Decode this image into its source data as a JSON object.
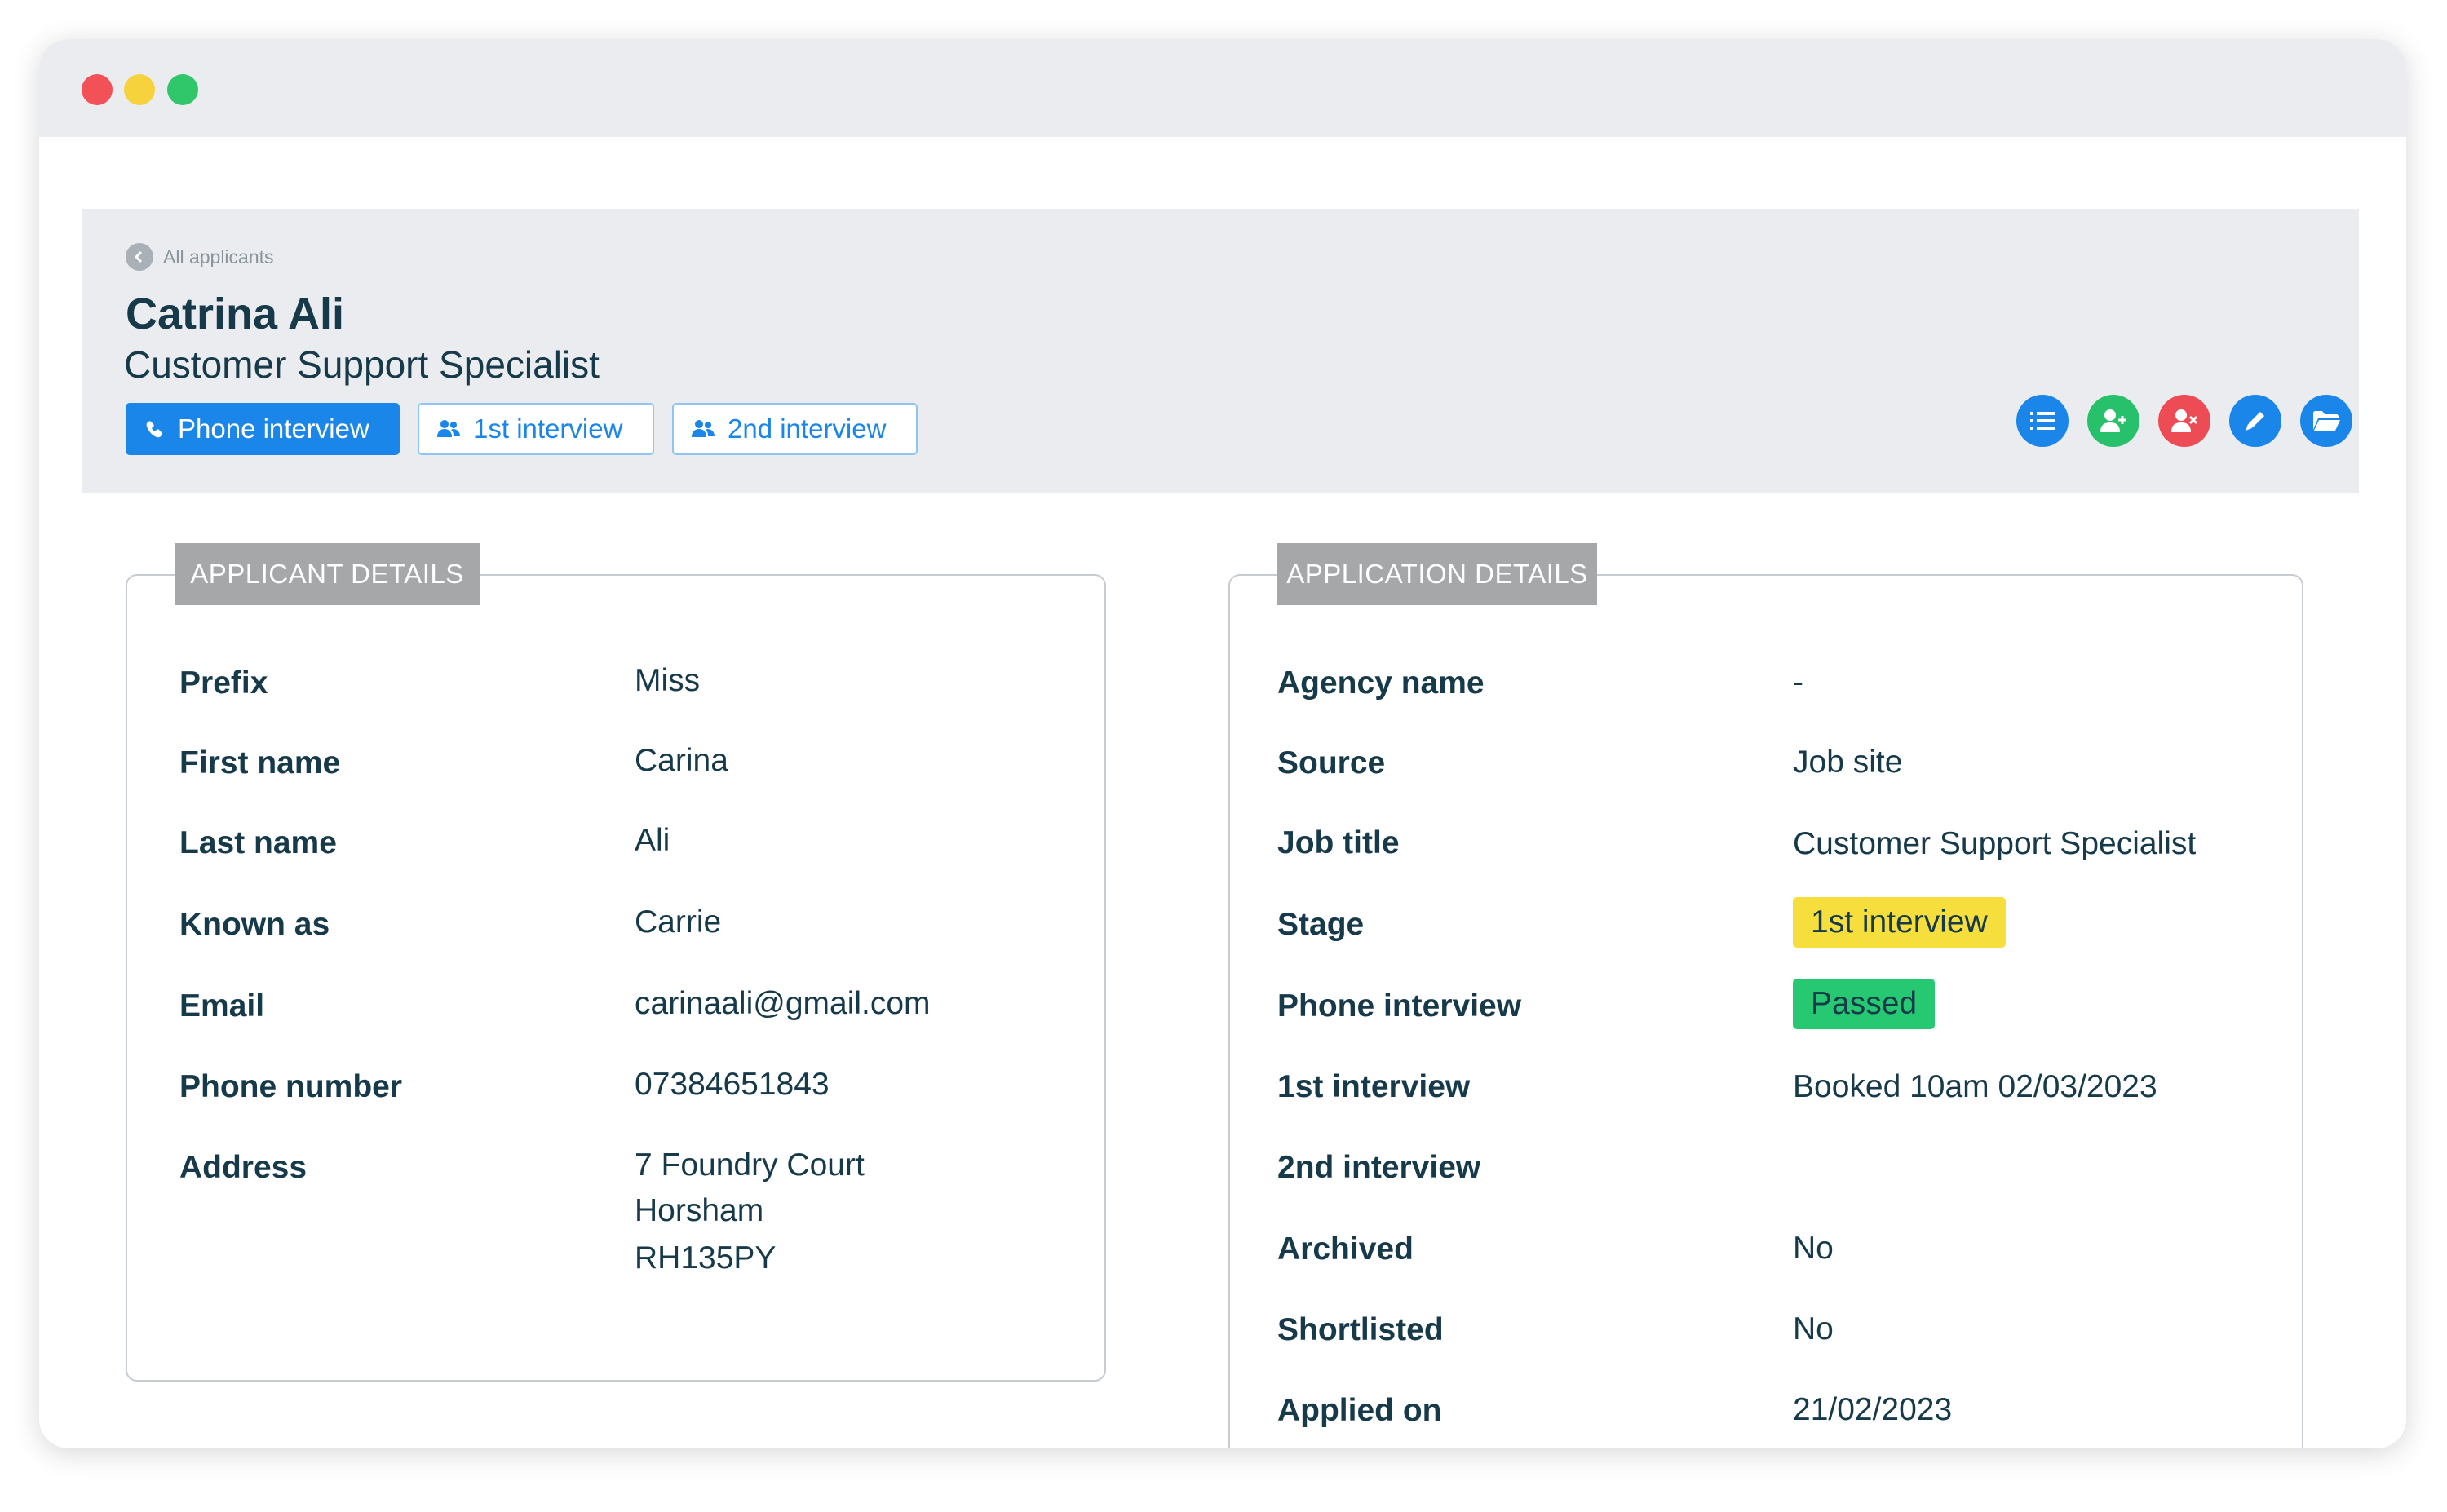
{
  "breadcrumb": {
    "label": "All applicants"
  },
  "applicant": {
    "name": "Catrina Ali",
    "job_title": "Customer Support Specialist"
  },
  "stage_tabs": [
    {
      "label": "Phone interview",
      "icon": "phone-icon",
      "active": true
    },
    {
      "label": "1st interview",
      "icon": "users-icon",
      "active": false
    },
    {
      "label": "2nd interview",
      "icon": "users-icon",
      "active": false
    }
  ],
  "actions": [
    {
      "icon": "list-icon",
      "color": "#1a86ea"
    },
    {
      "icon": "user-plus-icon",
      "color": "#26c16a"
    },
    {
      "icon": "user-remove-icon",
      "color": "#ee4c55"
    },
    {
      "icon": "pencil-icon",
      "color": "#1a86ea"
    },
    {
      "icon": "folder-icon",
      "color": "#1a86ea"
    }
  ],
  "applicant_details": {
    "title": "APPLICANT DETAILS",
    "rows": [
      {
        "label": "Prefix",
        "value": "Miss"
      },
      {
        "label": "First name",
        "value": "Carina"
      },
      {
        "label": "Last name",
        "value": "Ali"
      },
      {
        "label": "Known as",
        "value": "Carrie"
      },
      {
        "label": "Email",
        "value": "carinaali@gmail.com"
      },
      {
        "label": "Phone number",
        "value": "07384651843"
      },
      {
        "label": "Address",
        "value_lines": [
          "7 Foundry Court",
          "Horsham",
          "RH135PY"
        ]
      }
    ]
  },
  "application_details": {
    "title": "APPLICATION DETAILS",
    "rows": [
      {
        "label": "Agency name",
        "value": "-"
      },
      {
        "label": "Source",
        "value": "Job site"
      },
      {
        "label": "Job title",
        "value": "Customer Support Specialist"
      },
      {
        "label": "Stage",
        "value": "1st interview",
        "badge_color": "#f6de3c"
      },
      {
        "label": "Phone interview",
        "value": "Passed",
        "badge_color": "#26c971"
      },
      {
        "label": "1st interview",
        "value": "Booked 10am 02/03/2023"
      },
      {
        "label": "2nd interview",
        "value": ""
      },
      {
        "label": "Archived",
        "value": "No"
      },
      {
        "label": "Shortlisted",
        "value": "No"
      },
      {
        "label": "Applied on",
        "value": "21/02/2023"
      }
    ]
  }
}
